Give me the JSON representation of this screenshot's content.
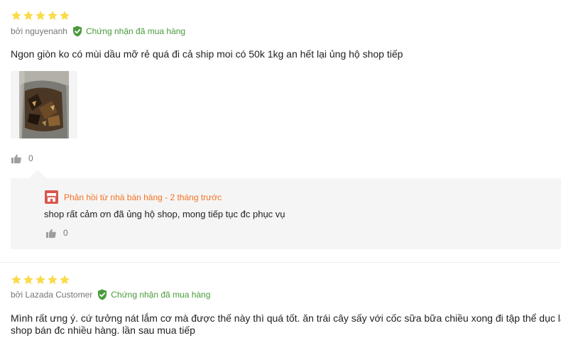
{
  "colors": {
    "star": "#fadb4b",
    "verified": "#4a9a3c",
    "seller_accent": "#f57224",
    "reply_bg": "#f5f5f5",
    "muted_text": "#757575"
  },
  "reviews": [
    {
      "rating": 5,
      "author": "bởi nguyenanh",
      "verified_label": "Chứng nhận đã mua hàng",
      "content": "Ngon giòn ko có mùi dầu mỡ rẻ quá đi cả ship moi có 50k 1kg an hết lại ủng hộ shop tiếp",
      "like_count": "0",
      "seller_reply": {
        "header": "Phản hồi từ nhà bán hàng - 2 tháng trước",
        "text": "shop rất cảm ơn đã ủng hộ shop, mong tiếp tục đc phục vụ",
        "like_count": "0"
      }
    },
    {
      "rating": 5,
      "author": "bởi Lazada Customer",
      "verified_label": "Chứng nhận đã mua hàng",
      "content_lines": [
        "Mình rất ưng ý. cứ tưởng nát lắm cơ mà được thế này thì quá tốt. ăn trái cây sấy với cốc sữa bữa chiều xong đi tập thể dục là",
        "shop bán đc nhiều hàng. lần sau mua tiếp"
      ]
    }
  ]
}
